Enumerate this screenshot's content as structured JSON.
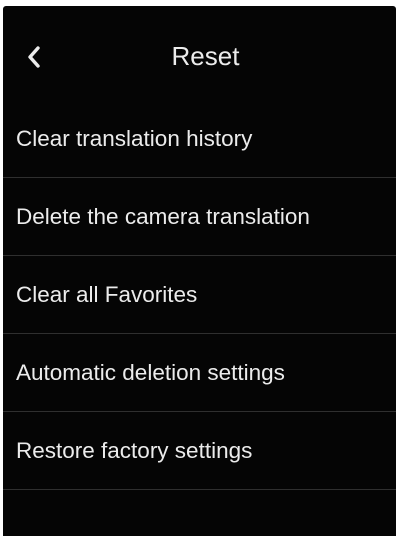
{
  "header": {
    "title": "Reset",
    "back_icon": "chevron-left-icon"
  },
  "menu": {
    "items": [
      {
        "label": "Clear translation history"
      },
      {
        "label": "Delete the camera translation"
      },
      {
        "label": "Clear all Favorites"
      },
      {
        "label": "Automatic deletion settings"
      },
      {
        "label": "Restore factory settings"
      }
    ]
  },
  "colors": {
    "background": "#050505",
    "text": "#ececec",
    "divider": "#2f2f2f"
  }
}
